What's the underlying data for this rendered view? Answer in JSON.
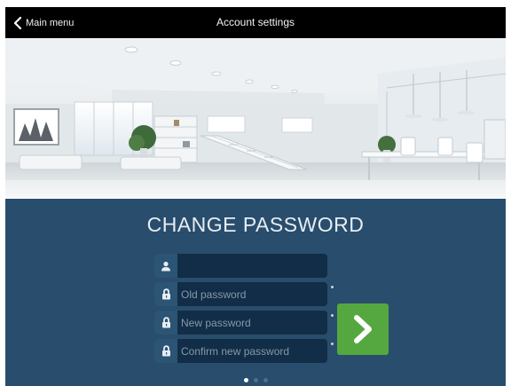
{
  "topbar": {
    "back_label": "Main menu",
    "title": "Account settings"
  },
  "form": {
    "heading": "CHANGE PASSWORD",
    "fields": [
      {
        "icon": "user-icon",
        "placeholder": ""
      },
      {
        "icon": "lock-icon",
        "placeholder": "Old password"
      },
      {
        "icon": "lock-icon",
        "placeholder": "New password"
      },
      {
        "icon": "lock-icon",
        "placeholder": "Confirm new password"
      }
    ],
    "submit_icon": "chevron-right-icon",
    "pager": {
      "pages": 3,
      "active": 1
    }
  },
  "colors": {
    "topbar_bg": "#000000",
    "panel_bg": "#294d6c",
    "field_bg": "#122d47",
    "submit_bg": "#55a83f"
  }
}
